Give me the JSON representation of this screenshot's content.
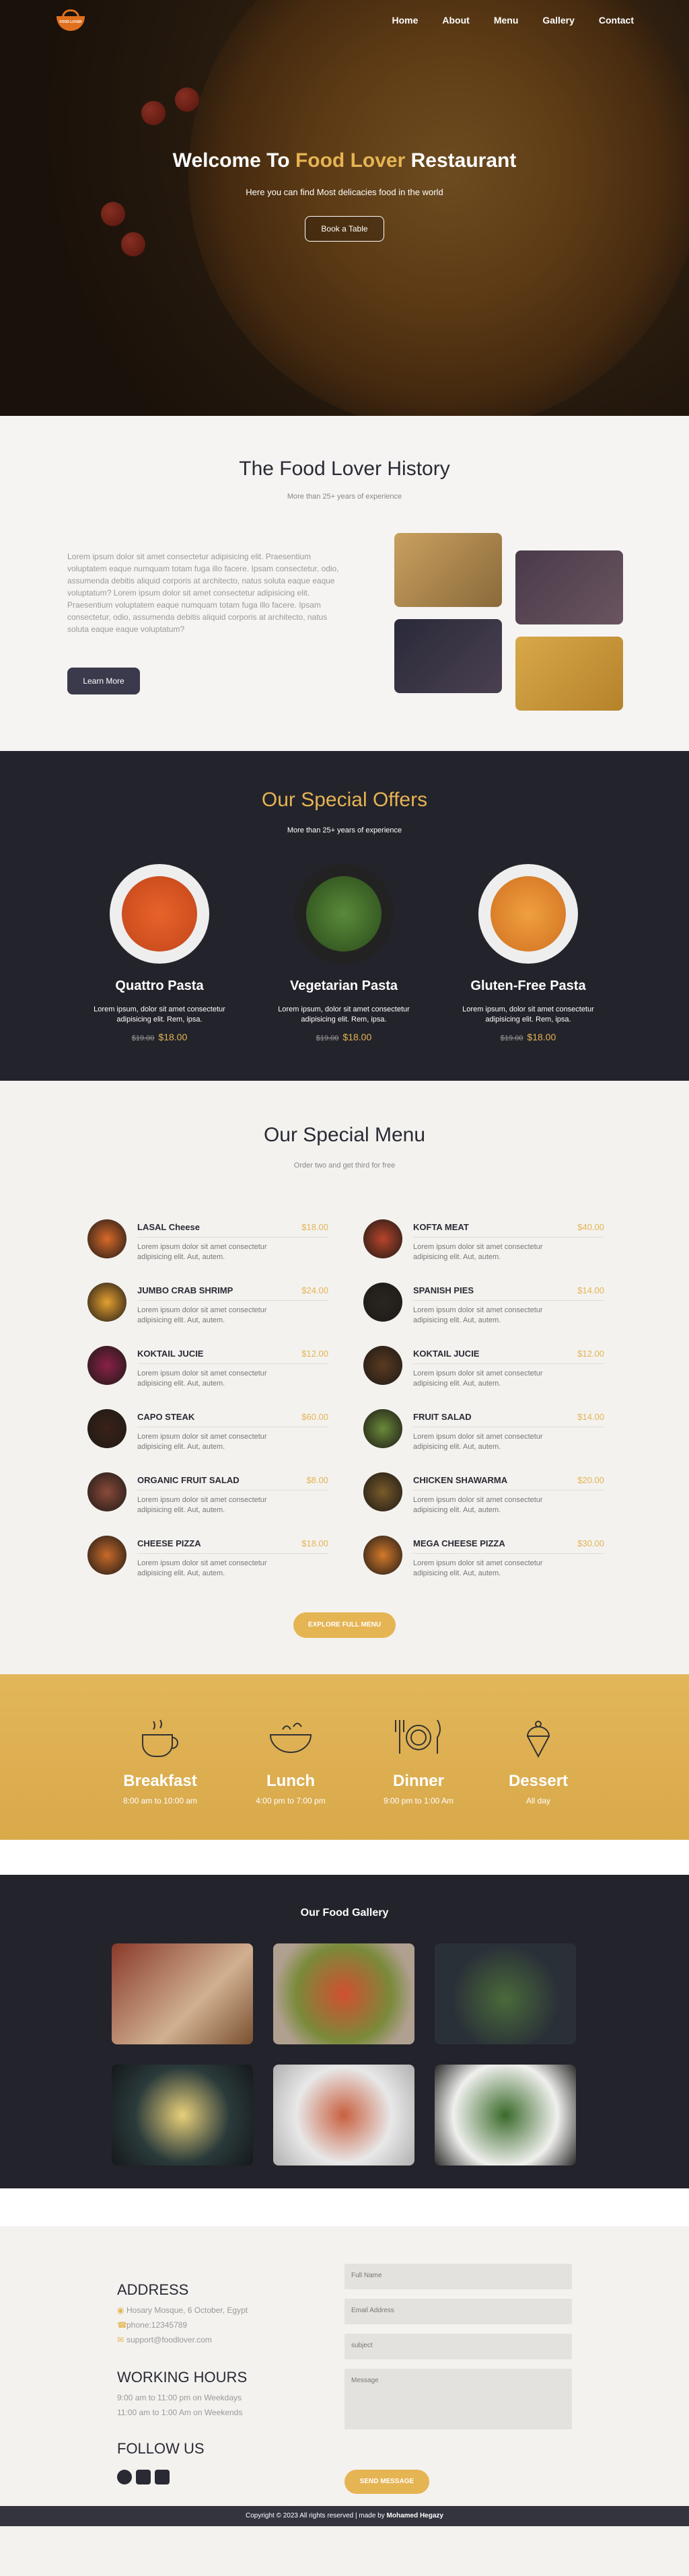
{
  "nav": {
    "logo_text": "FOOD LOVER",
    "links": [
      "Home",
      "About",
      "Menu",
      "Gallery",
      "Contact"
    ]
  },
  "hero": {
    "title_pre": "Welcome To ",
    "title_accent": "Food Lover",
    "title_post": " Restaurant",
    "subtitle": "Here you can find Most delicacies food in the world",
    "button": "Book a Table"
  },
  "history": {
    "title": "The Food Lover History",
    "subtitle": "More than 25+ years of experience",
    "paragraph": "Lorem ipsum dolor sit amet consectetur adipisicing elit. Praesentium voluptatem eaque numquam totam fuga illo facere. Ipsam consectetur, odio, assumenda debitis aliquid corporis at architecto, natus soluta eaque eaque voluptatum? Lorem ipsum dolor sit amet consectetur adipisicing elit. Praesentium voluptatem eaque numquam totam fuga illo facere. Ipsam consectetur, odio, assumenda debitis aliquid corporis at architecto, natus soluta eaque eaque voluptatum?",
    "button": "Learn More"
  },
  "offers": {
    "title": "Our Special Offers",
    "subtitle": "More than 25+ years of experience",
    "items": [
      {
        "name": "Quattro Pasta",
        "desc": "Lorem ipsum, dolor sit amet consectetur adipisicing elit. Rem, ipsa.",
        "old": "$19.00",
        "new": "$18.00"
      },
      {
        "name": "Vegetarian Pasta",
        "desc": "Lorem ipsum, dolor sit amet consectetur adipisicing elit. Rem, ipsa.",
        "old": "$19.00",
        "new": "$18.00"
      },
      {
        "name": "Gluten-Free Pasta",
        "desc": "Lorem ipsum, dolor sit amet consectetur adipisicing elit. Rem, ipsa.",
        "old": "$19.00",
        "new": "$18.00"
      }
    ]
  },
  "menu": {
    "title": "Our Special Menu",
    "subtitle": "Order two and get third for free",
    "items": [
      {
        "name": "LASAL Cheese",
        "price": "$18.00",
        "desc": "Lorem ipsum dolor sit amet consectetur adipisicing elit. Aut, autem."
      },
      {
        "name": "KOFTA MEAT",
        "price": "$40.00",
        "desc": "Lorem ipsum dolor sit amet consectetur adipisicing elit. Aut, autem."
      },
      {
        "name": "JUMBO CRAB SHRIMP",
        "price": "$24.00",
        "desc": "Lorem ipsum dolor sit amet consectetur adipisicing elit. Aut, autem."
      },
      {
        "name": "SPANISH PIES",
        "price": "$14.00",
        "desc": "Lorem ipsum dolor sit amet consectetur adipisicing elit. Aut, autem."
      },
      {
        "name": "KOKTAIL JUCIE",
        "price": "$12.00",
        "desc": "Lorem ipsum dolor sit amet consectetur adipisicing elit. Aut, autem."
      },
      {
        "name": "KOKTAIL JUCIE",
        "price": "$12.00",
        "desc": "Lorem ipsum dolor sit amet consectetur adipisicing elit. Aut, autem."
      },
      {
        "name": "CAPO STEAK",
        "price": "$60.00",
        "desc": "Lorem ipsum dolor sit amet consectetur adipisicing elit. Aut, autem."
      },
      {
        "name": "FRUIT SALAD",
        "price": "$14.00",
        "desc": "Lorem ipsum dolor sit amet consectetur adipisicing elit. Aut, autem."
      },
      {
        "name": "ORGANIC FRUIT SALAD",
        "price": "$8.00",
        "desc": "Lorem ipsum dolor sit amet consectetur adipisicing elit. Aut, autem."
      },
      {
        "name": "CHICKEN SHAWARMA",
        "price": "$20.00",
        "desc": "Lorem ipsum dolor sit amet consectetur adipisicing elit. Aut, autem."
      },
      {
        "name": "CHEESE PIZZA",
        "price": "$18.00",
        "desc": "Lorem ipsum dolor sit amet consectetur adipisicing elit. Aut, autem."
      },
      {
        "name": "MEGA CHEESE PIZZA",
        "price": "$30.00",
        "desc": "Lorem ipsum dolor sit amet consectetur adipisicing elit. Aut, autem."
      }
    ],
    "button": "EXPLORE FULL MENU"
  },
  "hours": [
    {
      "title": "Breakfast",
      "time": "8:00 am to 10:00 am",
      "icon": "cup-icon"
    },
    {
      "title": "Lunch",
      "time": "4:00 pm to 7:00 pm",
      "icon": "bowl-icon"
    },
    {
      "title": "Dinner",
      "time": "9:00 pm to 1:00 Am",
      "icon": "plate-icon"
    },
    {
      "title": "Dessert",
      "time": "All day",
      "icon": "icecream-icon"
    }
  ],
  "gallery": {
    "title": "Our Food Gallery"
  },
  "contact": {
    "address_title": "ADDRESS",
    "address": "Hosary Mosque, 6 October, Egypt",
    "phone": "phone:12345789",
    "email": "support@foodlover.com",
    "hours_title": "WORKING HOURS",
    "hours_1": "9:00 am to 11:00 pm on Weekdays",
    "hours_2": "11:00 am to 1:00 Am on Weekends",
    "follow_title": "FOLLOW US",
    "placeholder_name": "Full Name",
    "placeholder_email": "Email Address",
    "placeholder_subject": "subject",
    "placeholder_message": "Message",
    "button": "SEND MESSAGE"
  },
  "footer": {
    "text": "Copyright © 2023 All rights reserved | made by ",
    "author": "Mohamed Hegazy"
  },
  "colors": {
    "accent": "#e5b453",
    "dark": "#23232b",
    "light": "#f3f2ef"
  }
}
